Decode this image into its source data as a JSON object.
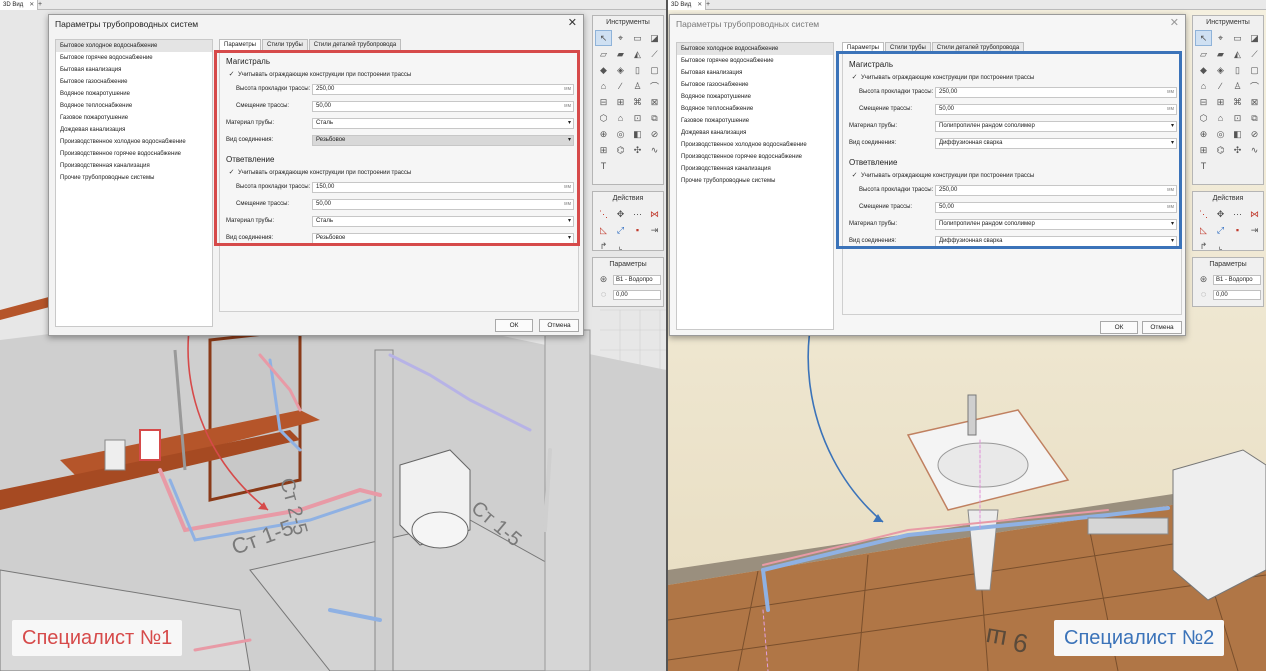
{
  "left": {
    "view_tab": "3D Вид",
    "dialog": {
      "title": "Параметры трубопроводных систем",
      "categories": [
        "Бытовое холодное водоснабжение",
        "Бытовое горячее водоснабжение",
        "Бытовая канализация",
        "Бытовое газоснабжение",
        "Водяное пожаротушение",
        "Водяное теплоснабжение",
        "Газовое пожаротушение",
        "Дождевая канализация",
        "Производственное холодное водоснабжение",
        "Производственное горячее водоснабжение",
        "Производственная канализация",
        "Прочие трубопроводные системы"
      ],
      "tabs": [
        "Параметры",
        "Стили трубы",
        "Стили деталей трубопровода"
      ],
      "main": {
        "title": "Магистраль",
        "consider_label": "Учитывать ограждающие конструкции при построении трассы",
        "height_label": "Высота прокладки трассы:",
        "height_value": "250,00",
        "offset_label": "Смещение трассы:",
        "offset_value": "50,00",
        "material_label": "Материал трубы:",
        "material_value": "Сталь",
        "connection_label": "Вид соединения:",
        "connection_value": "Резьбовое"
      },
      "branch": {
        "title": "Ответвление",
        "consider_label": "Учитывать ограждающие конструкции при построении трассы",
        "height_label": "Высота прокладки трассы:",
        "height_value": "150,00",
        "offset_label": "Смещение трассы:",
        "offset_value": "50,00",
        "material_label": "Материал трубы:",
        "material_value": "Сталь",
        "connection_label": "Вид соединения:",
        "connection_value": "Резьбовое"
      },
      "unit": "мм",
      "ok_label": "ОК",
      "cancel_label": "Отмена"
    },
    "palette": {
      "tools_title": "Инструменты",
      "actions_title": "Действия",
      "params_title": "Параметры",
      "system_value": "В1 - Водопро",
      "offset_value": "0,00"
    },
    "specialist_label": "Специалист №1"
  },
  "right": {
    "view_tab": "3D Вид",
    "dialog": {
      "title": "Параметры трубопроводных систем",
      "categories": [
        "Бытовое холодное водоснабжение",
        "Бытовое горячее водоснабжение",
        "Бытовая канализация",
        "Бытовое газоснабжение",
        "Водяное пожаротушение",
        "Водяное теплоснабжение",
        "Газовое пожаротушение",
        "Дождевая канализация",
        "Производственное холодное водоснабжение",
        "Производственное горячее водоснабжение",
        "Производственная канализация",
        "Прочие трубопроводные системы"
      ],
      "tabs": [
        "Параметры",
        "Стили трубы",
        "Стили деталей трубопровода"
      ],
      "main": {
        "title": "Магистраль",
        "consider_label": "Учитывать ограждающие конструкции при построении трассы",
        "height_label": "Высота прокладки трассы:",
        "height_value": "250,00",
        "offset_label": "Смещение трассы:",
        "offset_value": "50,00",
        "material_label": "Материал трубы:",
        "material_value": "Полипропилен рандом сополимер",
        "connection_label": "Вид соединения:",
        "connection_value": "Диффузионная сварка"
      },
      "branch": {
        "title": "Ответвление",
        "consider_label": "Учитывать ограждающие конструкции при построении трассы",
        "height_label": "Высота прокладки трассы:",
        "height_value": "250,00",
        "offset_label": "Смещение трассы:",
        "offset_value": "50,00",
        "material_label": "Материал трубы:",
        "material_value": "Полипропилен рандом сополимер",
        "connection_label": "Вид соединения:",
        "connection_value": "Диффузионная сварка"
      },
      "unit": "мм",
      "ok_label": "ОК",
      "cancel_label": "Отмена"
    },
    "palette": {
      "tools_title": "Инструменты",
      "actions_title": "Действия",
      "params_title": "Параметры",
      "system_value": "В1 - Водопро",
      "offset_value": "0,00"
    },
    "specialist_label": "Специалист №2"
  },
  "scene_labels": {
    "left_riser_a": "Ст 1-5",
    "left_riser_b": "Ст 2-5",
    "left_riser_c": "Ст 1-5",
    "right_floor": "9 ш"
  },
  "colors": {
    "highlight_left": "#d64a4a",
    "highlight_right": "#3b73b9",
    "pipe_hot": "#e89aa6",
    "pipe_cold": "#8fb1e3",
    "wall_wood": "#b5552a",
    "floor_tile": "#b07646"
  }
}
